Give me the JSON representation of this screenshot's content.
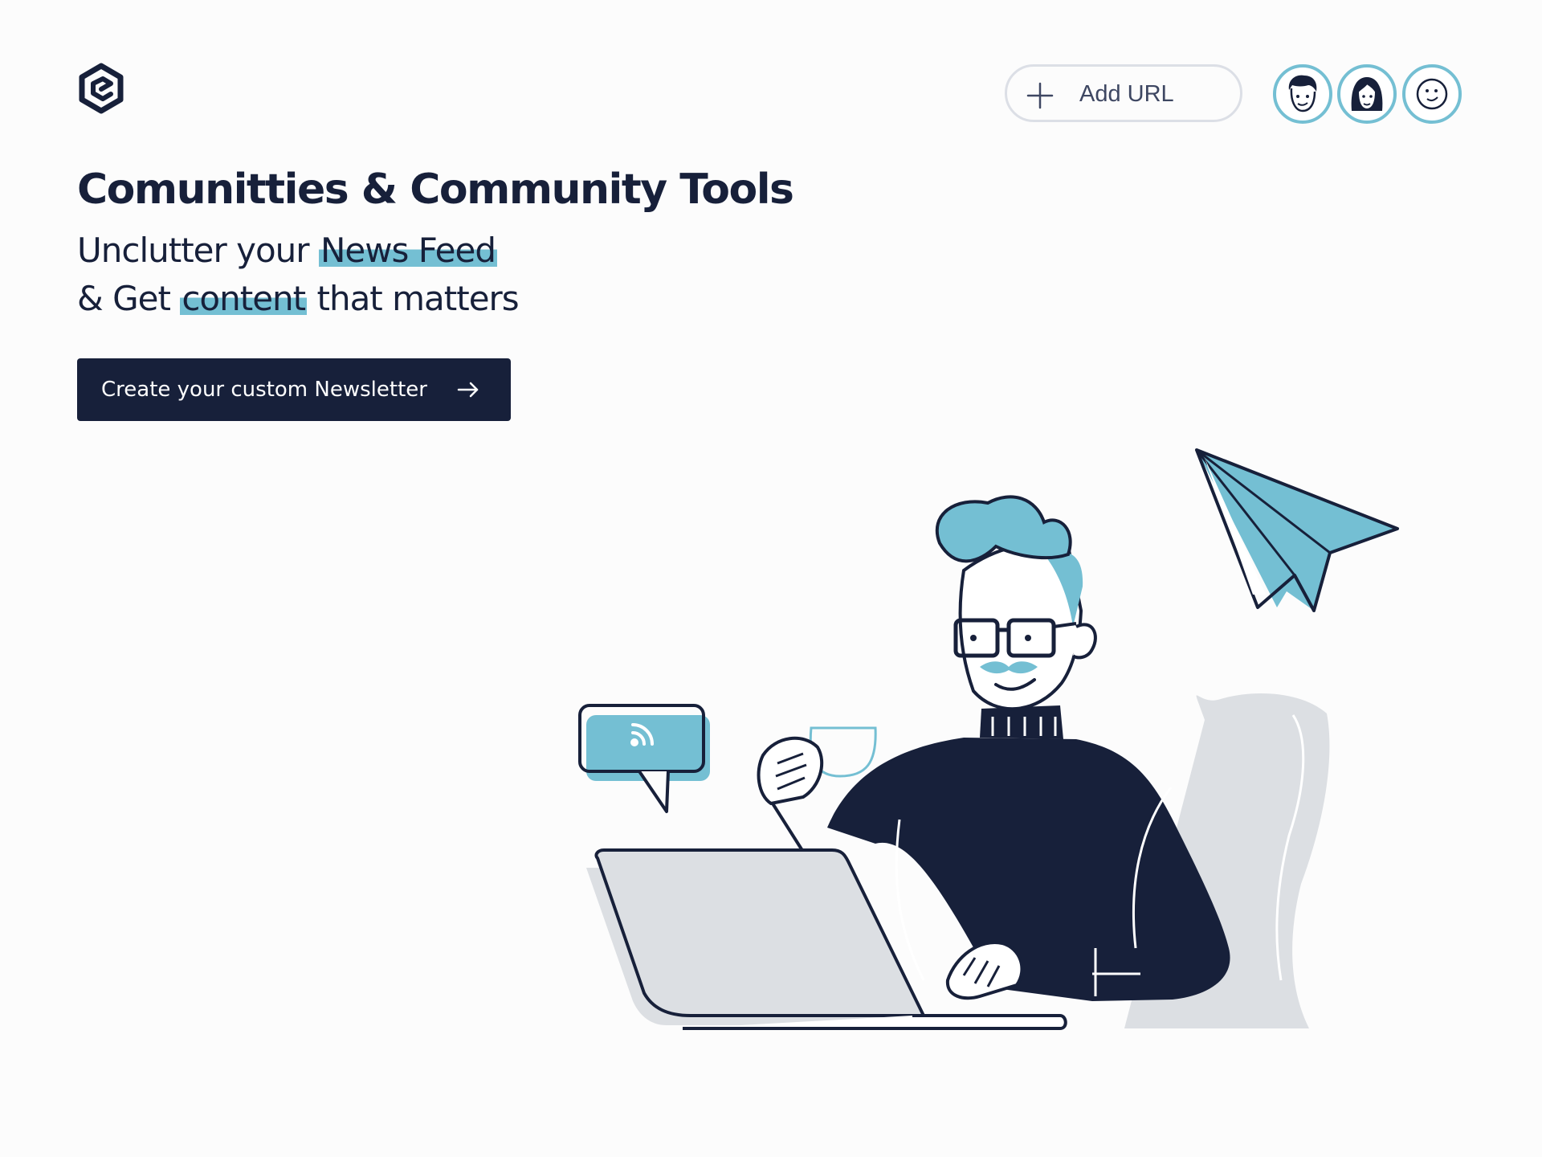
{
  "header": {
    "logo_icon": "e-hexagon-logo-icon",
    "add_url": {
      "icon": "plus-icon",
      "label": "Add URL"
    },
    "avatars": [
      {
        "name": "avatar-man",
        "icon": "man-face-icon"
      },
      {
        "name": "avatar-woman",
        "icon": "woman-face-icon"
      },
      {
        "name": "avatar-smile",
        "icon": "smiley-face-icon"
      }
    ]
  },
  "hero": {
    "title": "Comunitties & Community Tools",
    "subtitle_line1_pre": "Unclutter your ",
    "subtitle_line1_highlight": "News Feed",
    "subtitle_line2_pre": "& Get ",
    "subtitle_line2_highlight": "content",
    "subtitle_line2_post": " that matters",
    "cta_label": "Create your custom Newsletter",
    "cta_icon": "arrow-right-icon"
  },
  "illustration": {
    "subject": "man-at-laptop-illustration",
    "elements": [
      "paper-plane-icon",
      "rss-speech-bubble-icon",
      "coffee-cup-icon",
      "chair-icon",
      "laptop-icon"
    ]
  },
  "colors": {
    "navy": "#17203a",
    "accent": "#74bfd3",
    "light_gray": "#dcdfe3",
    "background": "#fcfcfc"
  }
}
